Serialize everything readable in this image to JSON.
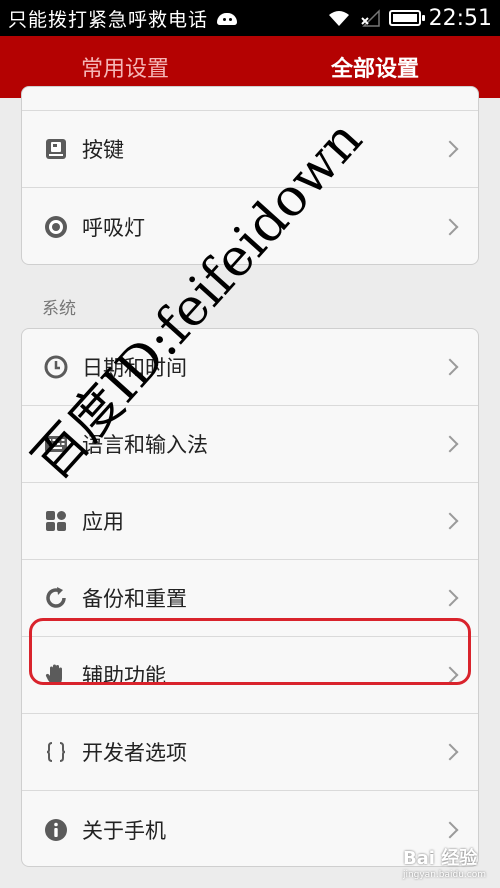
{
  "status_bar": {
    "carrier_text": "只能拨打紧急呼救电话",
    "time": "22:51",
    "icons": [
      "android-icon",
      "wifi-icon",
      "no-signal-icon",
      "battery-icon"
    ]
  },
  "header": {
    "tabs": [
      {
        "label": "常用设置",
        "active": false
      },
      {
        "label": "全部设置",
        "active": true
      }
    ]
  },
  "top_group": {
    "items": [
      {
        "label": "按键",
        "icon": "key-icon"
      },
      {
        "label": "呼吸灯",
        "icon": "breathing-light-icon"
      }
    ]
  },
  "system_section": {
    "title": "系统",
    "items": [
      {
        "label": "日期和时间",
        "icon": "clock-icon"
      },
      {
        "label": "语言和输入法",
        "icon": "keyboard-icon"
      },
      {
        "label": "应用",
        "icon": "apps-icon"
      },
      {
        "label": "备份和重置",
        "icon": "backup-icon"
      },
      {
        "label": "辅助功能",
        "icon": "hand-icon"
      },
      {
        "label": "开发者选项",
        "icon": "braces-icon",
        "highlighted": true
      },
      {
        "label": "关于手机",
        "icon": "info-icon"
      }
    ]
  },
  "watermark": {
    "text": "百度ID:feifeidown",
    "logo_text": "Bai 经验",
    "logo_sub": "jingyan.baidu.com"
  },
  "colors": {
    "header_bg": "#b40202",
    "highlight": "#d9232c"
  }
}
